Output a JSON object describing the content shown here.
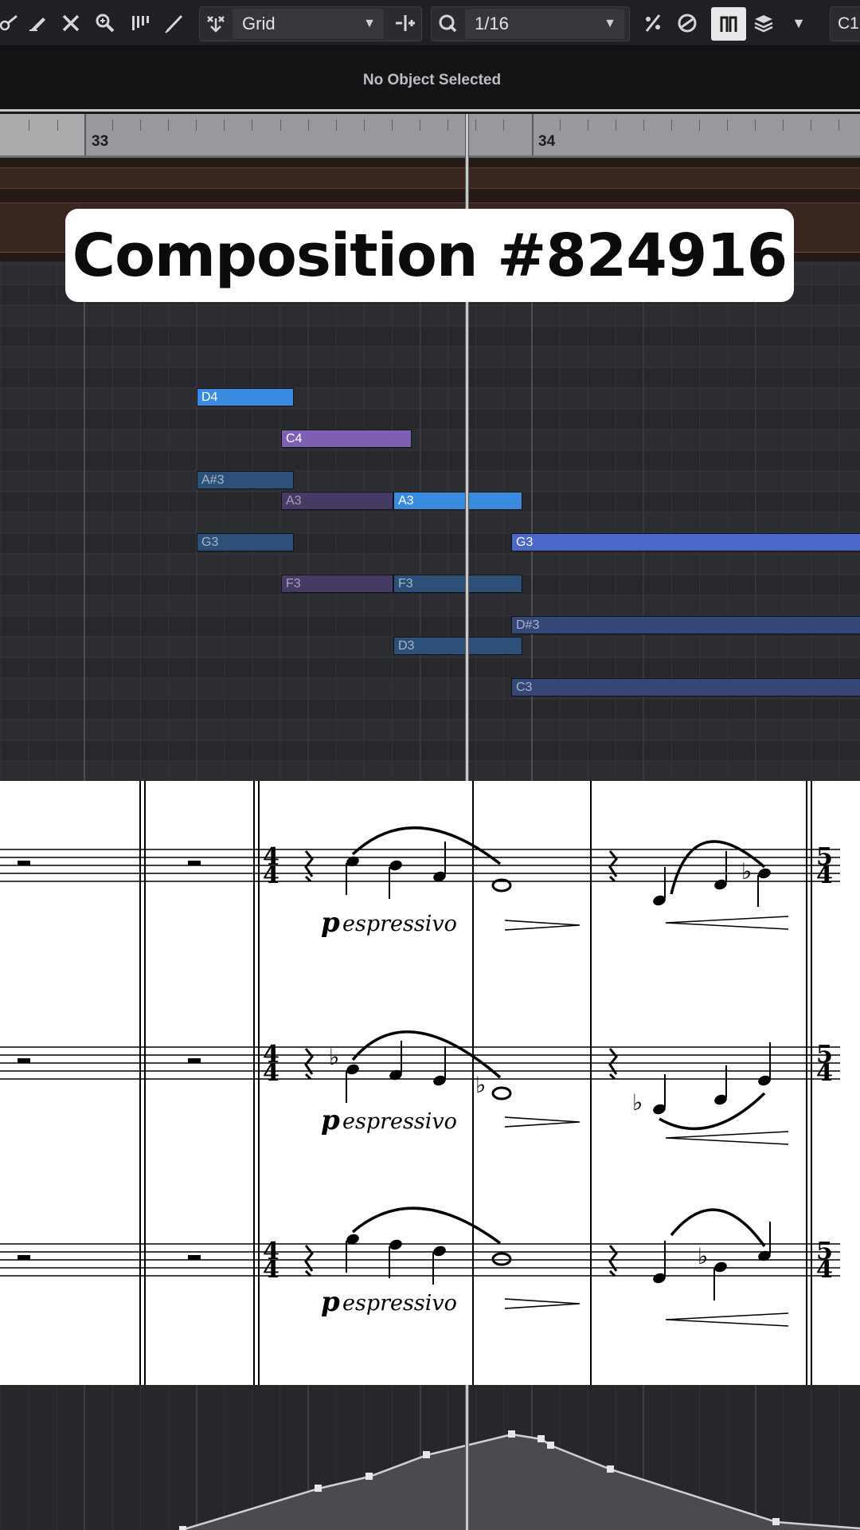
{
  "toolbar": {
    "snap_type": "Grid",
    "quantize_value": "1/16",
    "right_label": "C1",
    "dropdown_arrow": "▼"
  },
  "info_line": {
    "status": "No Object Selected"
  },
  "ruler": {
    "bar_start": "33",
    "bar_next": "34"
  },
  "overlay": {
    "title": "Composition #824916"
  },
  "piano_roll": {
    "notes": [
      {
        "label": "D4",
        "color": "#3a8be0",
        "text": "#ffffff"
      },
      {
        "label": "C4",
        "color": "#7d5fb3",
        "text": "#ffffff"
      },
      {
        "label": "A#3",
        "color": "#2d5078",
        "text": "#a7b7c9"
      },
      {
        "label": "A3",
        "color": "#453b63",
        "text": "#a9a0bd"
      },
      {
        "label": "A3",
        "color": "#3a8be0",
        "text": "#ffffff"
      },
      {
        "label": "G3",
        "color": "#2d5078",
        "text": "#a7b7c9"
      },
      {
        "label": "G3",
        "color": "#4968c7",
        "text": "#ffffff"
      },
      {
        "label": "F3",
        "color": "#453b63",
        "text": "#a9a0bd"
      },
      {
        "label": "F3",
        "color": "#2d5078",
        "text": "#a7b7c9"
      },
      {
        "label": "D#3",
        "color": "#354776",
        "text": "#aab3cc"
      },
      {
        "label": "D3",
        "color": "#2d5078",
        "text": "#a7b7c9"
      },
      {
        "label": "C3",
        "color": "#354776",
        "text": "#aab3cc"
      }
    ]
  },
  "score": {
    "time_signature_4_4": [
      "4",
      "4"
    ],
    "time_signature_5_4": [
      "5",
      "4"
    ],
    "dynamic": "p",
    "expression": "espressivo",
    "staves": 3
  },
  "colors": {
    "toolbar_bg": "#1f2023",
    "piano_roll_bg": "#2a2b2f",
    "automation_line": "#cfd0d2"
  }
}
